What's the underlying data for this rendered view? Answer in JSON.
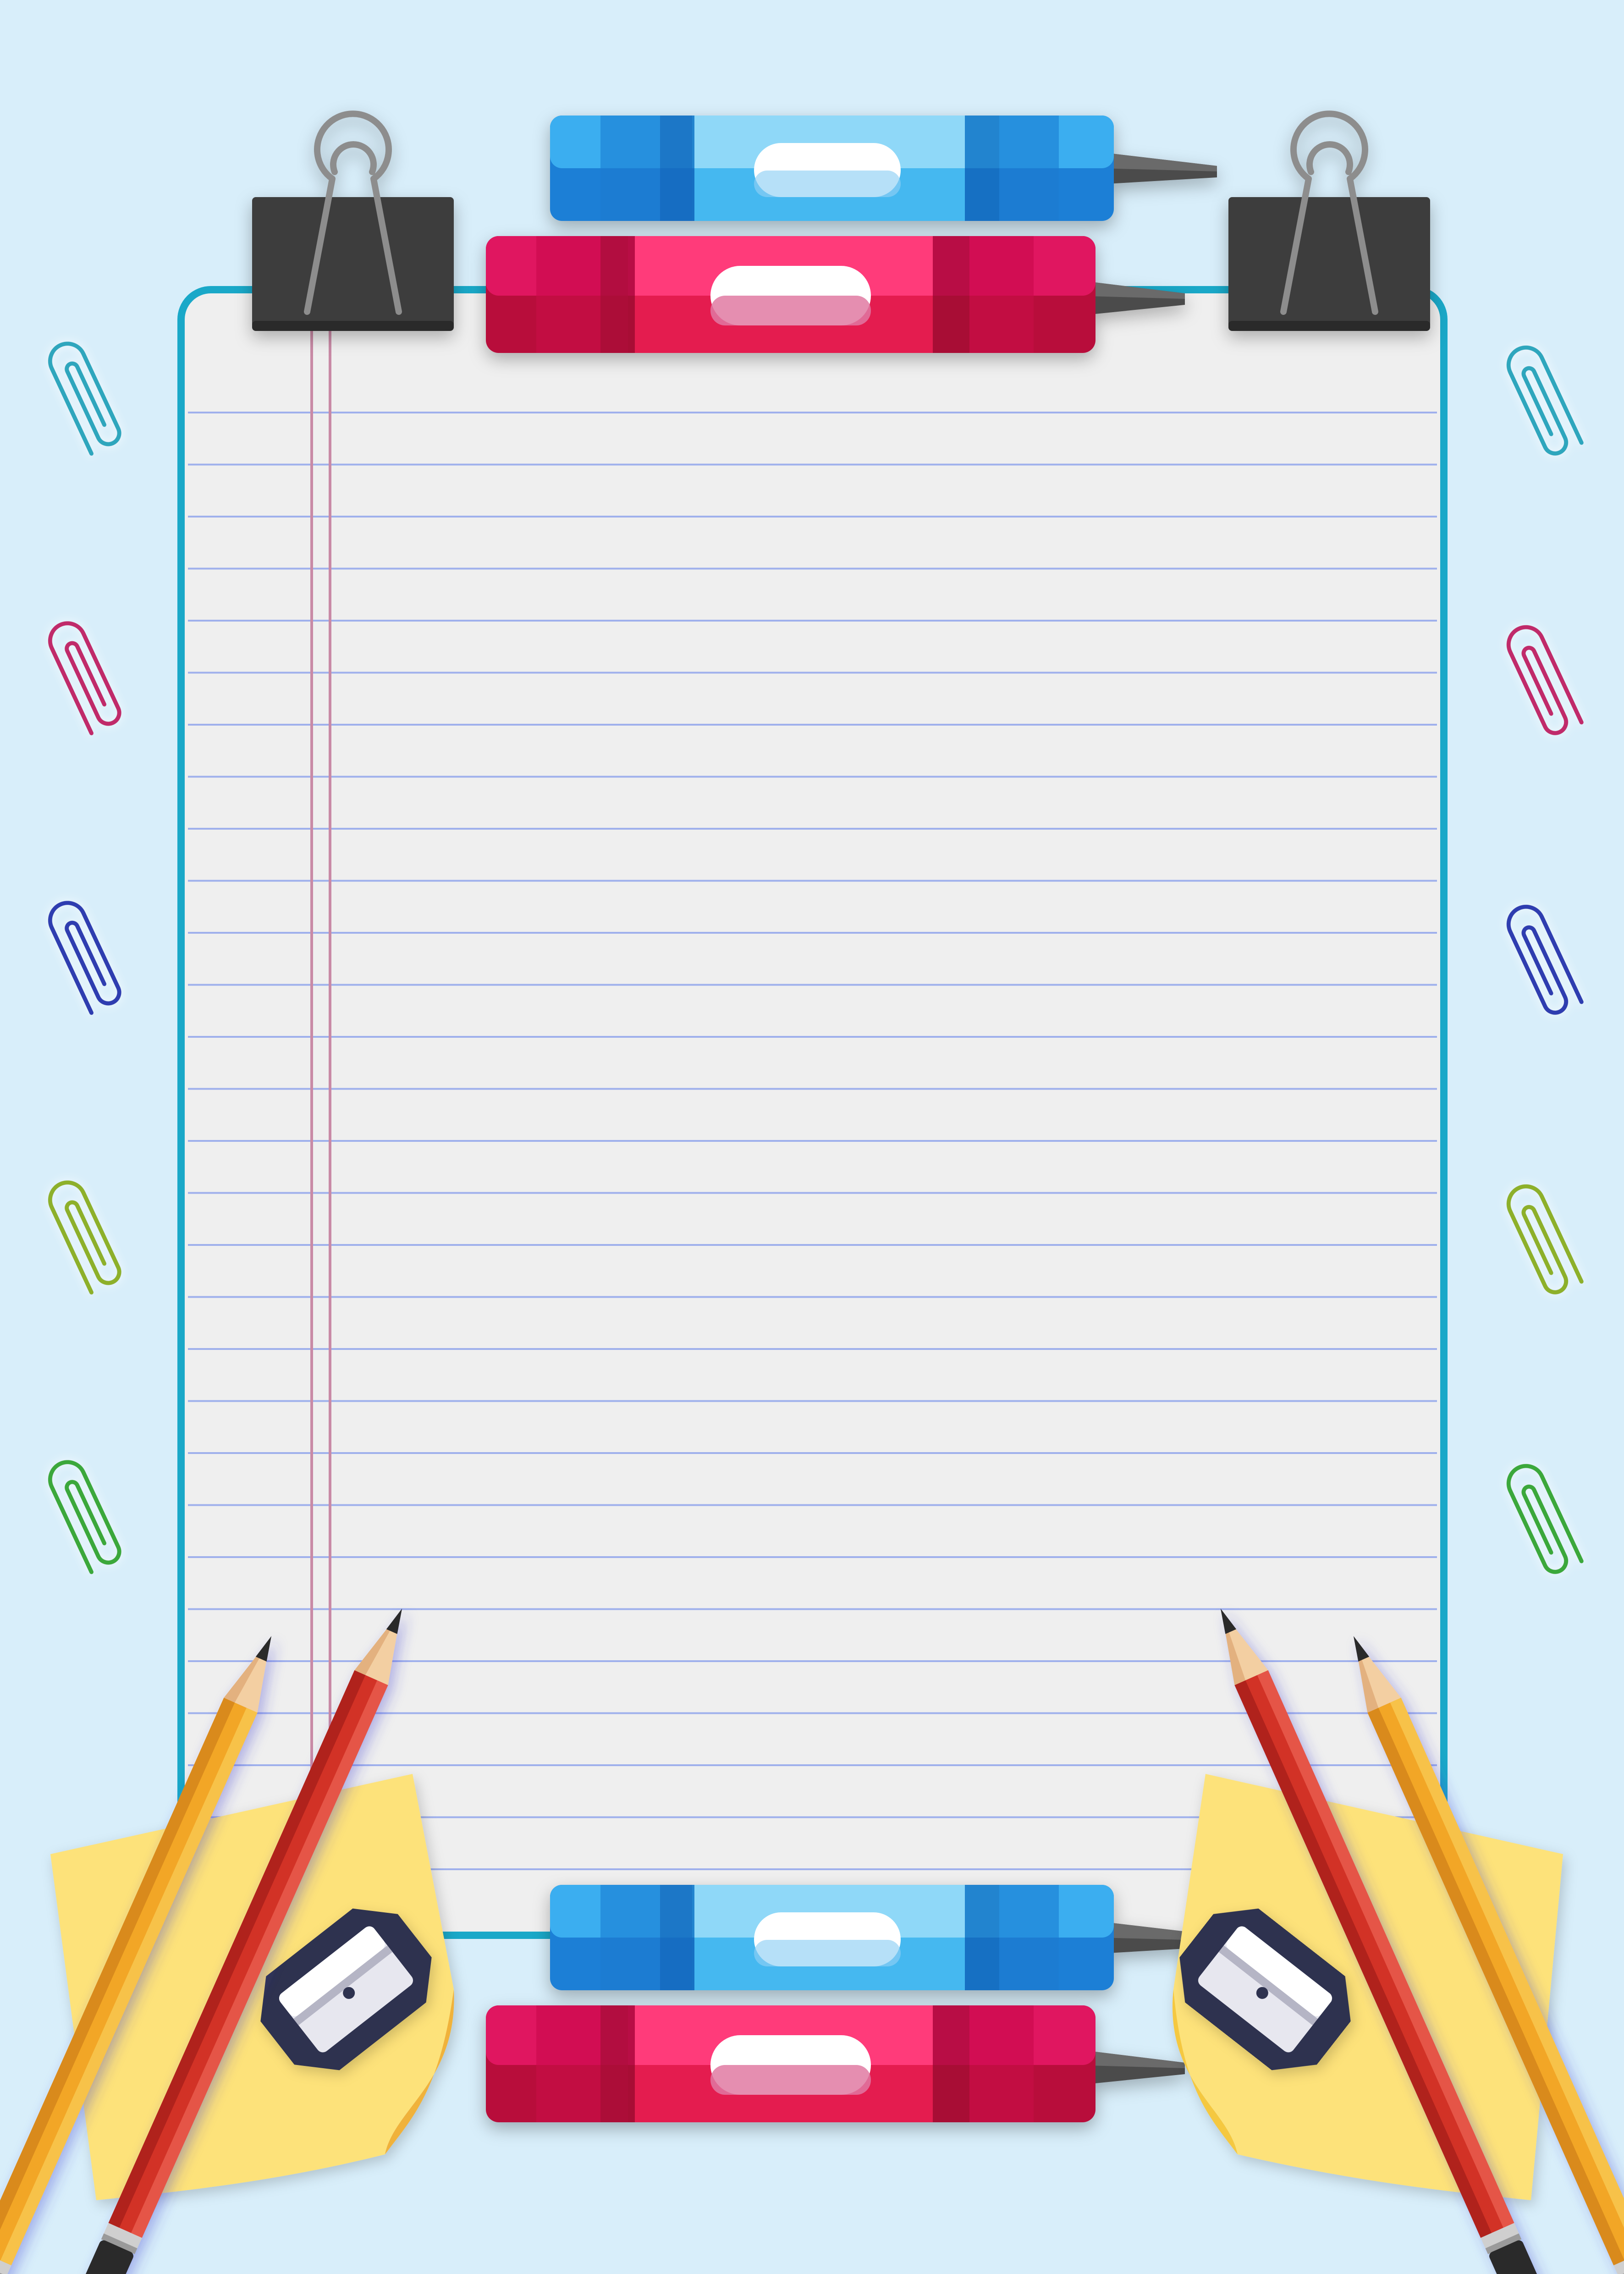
{
  "colors": {
    "background": "#d8eefa",
    "paper": "#efefef",
    "paper_border": "#1aa8c8",
    "ruled_line": "#9fb0ec",
    "margin_line": "#c98aa6",
    "binder_clip": "#3f3f3f",
    "binder_wire": "#8a8a8a",
    "crayon_blue": "#2f9be8",
    "crayon_red": "#e0174f",
    "pencil_yellow": "#f2a626",
    "pencil_red": "#d23227",
    "sticky_note": "#fde27a",
    "sharpener": "#2d3150"
  },
  "paperclips": {
    "left": [
      "#2fa6bd",
      "#c02c6a",
      "#2e3db0",
      "#8db02c",
      "#3aa83a"
    ],
    "right": [
      "#2fa6bd",
      "#c02c6a",
      "#2e3db0",
      "#8db02c",
      "#3aa83a"
    ]
  },
  "icons": {
    "clip": "binder-clip-icon",
    "paperclip": "paperclip-icon",
    "crayon": "crayon-icon",
    "pencil": "pencil-icon",
    "sharpener": "sharpener-icon",
    "note": "sticky-note-icon"
  }
}
